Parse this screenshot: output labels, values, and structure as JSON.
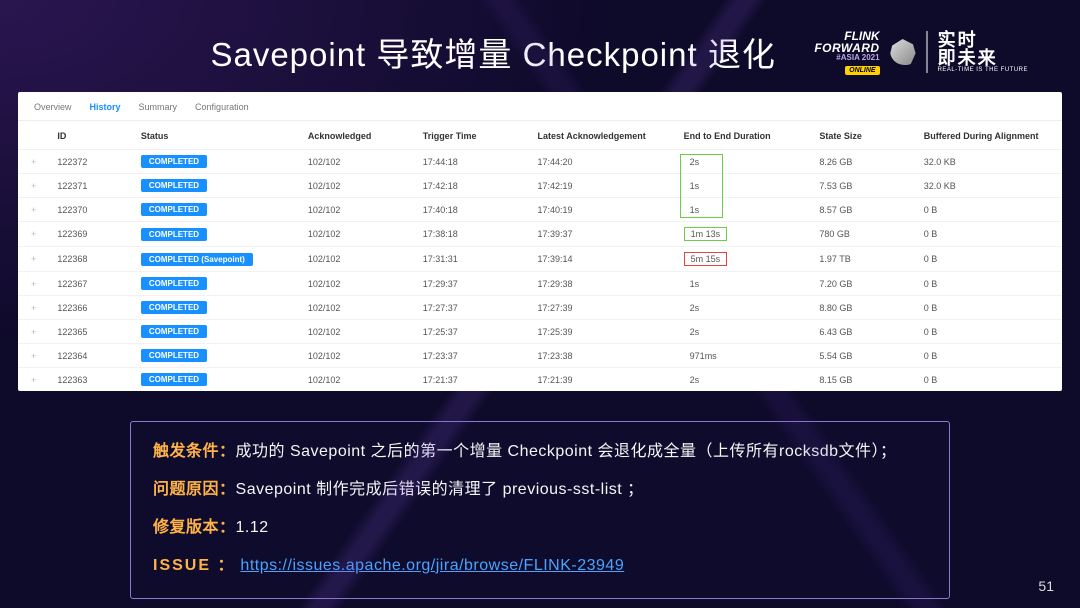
{
  "slide": {
    "title": "Savepoint 导致增量 Checkpoint 退化",
    "page_number": "51"
  },
  "logo": {
    "line1": "FLINK",
    "line2": "FORWARD",
    "asia": "#ASIA 2021",
    "online": "ONLINE",
    "cn_line1": "实时",
    "cn_line2": "即未来",
    "cn_sub": "REAL-TIME IS THE FUTURE"
  },
  "tabs": [
    "Overview",
    "History",
    "Summary",
    "Configuration"
  ],
  "active_tab": "History",
  "table": {
    "headers": [
      "",
      "ID",
      "Status",
      "Acknowledged",
      "Trigger Time",
      "Latest Acknowledgement",
      "End to End Duration",
      "State Size",
      "Buffered During Alignment"
    ],
    "rows": [
      {
        "id": "122372",
        "status": "COMPLETED",
        "ack": "102/102",
        "trigger": "17:44:18",
        "latest": "17:44:20",
        "dur": "2s",
        "size": "8.26 GB",
        "buf": "32.0 KB",
        "hl": "green-group"
      },
      {
        "id": "122371",
        "status": "COMPLETED",
        "ack": "102/102",
        "trigger": "17:42:18",
        "latest": "17:42:19",
        "dur": "1s",
        "size": "7.53 GB",
        "buf": "32.0 KB",
        "hl": "green-group"
      },
      {
        "id": "122370",
        "status": "COMPLETED",
        "ack": "102/102",
        "trigger": "17:40:18",
        "latest": "17:40:19",
        "dur": "1s",
        "size": "8.57 GB",
        "buf": "0 B",
        "hl": "green-group"
      },
      {
        "id": "122369",
        "status": "COMPLETED",
        "ack": "102/102",
        "trigger": "17:38:18",
        "latest": "17:39:37",
        "dur": "1m 13s",
        "size": "780 GB",
        "buf": "0 B",
        "hl": "hl-green"
      },
      {
        "id": "122368",
        "status": "COMPLETED (Savepoint)",
        "ack": "102/102",
        "trigger": "17:31:31",
        "latest": "17:39:14",
        "dur": "5m 15s",
        "size": "1.97 TB",
        "buf": "0 B",
        "hl": "hl-red"
      },
      {
        "id": "122367",
        "status": "COMPLETED",
        "ack": "102/102",
        "trigger": "17:29:37",
        "latest": "17:29:38",
        "dur": "1s",
        "size": "7.20 GB",
        "buf": "0 B",
        "hl": ""
      },
      {
        "id": "122366",
        "status": "COMPLETED",
        "ack": "102/102",
        "trigger": "17:27:37",
        "latest": "17:27:39",
        "dur": "2s",
        "size": "8.80 GB",
        "buf": "0 B",
        "hl": ""
      },
      {
        "id": "122365",
        "status": "COMPLETED",
        "ack": "102/102",
        "trigger": "17:25:37",
        "latest": "17:25:39",
        "dur": "2s",
        "size": "6.43 GB",
        "buf": "0 B",
        "hl": ""
      },
      {
        "id": "122364",
        "status": "COMPLETED",
        "ack": "102/102",
        "trigger": "17:23:37",
        "latest": "17:23:38",
        "dur": "971ms",
        "size": "5.54 GB",
        "buf": "0 B",
        "hl": ""
      },
      {
        "id": "122363",
        "status": "COMPLETED",
        "ack": "102/102",
        "trigger": "17:21:37",
        "latest": "17:21:39",
        "dur": "2s",
        "size": "8.15 GB",
        "buf": "0 B",
        "hl": ""
      }
    ]
  },
  "info": {
    "row1_label": "触发条件：",
    "row1_body": "成功的 Savepoint 之后的第一个增量 Checkpoint 会退化成全量（上传所有rocksdb文件）；",
    "row2_label": "问题原因：",
    "row2_body": "Savepoint 制作完成后错误的清理了 previous-sst-list ；",
    "row3_label": "修复版本：",
    "row3_body": "1.12",
    "row4_label": "ISSUE ：",
    "row4_link": "https://issues.apache.org/jira/browse/FLINK-23949"
  }
}
